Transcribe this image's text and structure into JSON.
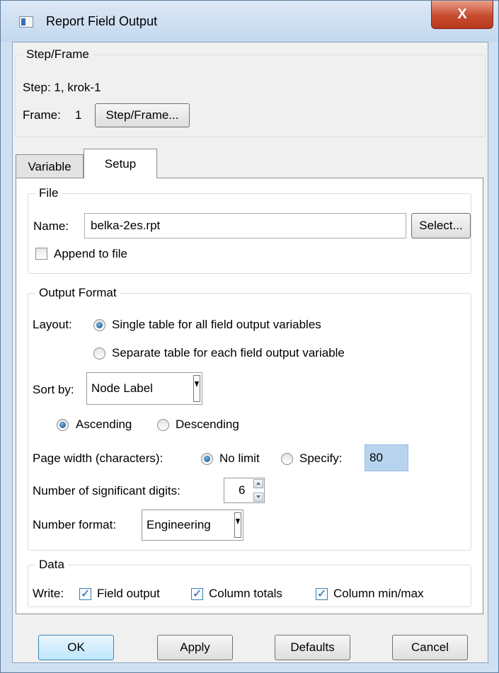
{
  "window": {
    "title": "Report Field Output",
    "close_label": "X"
  },
  "step_frame": {
    "legend": "Step/Frame",
    "step_text": "Step: 1, krok-1",
    "frame_label": "Frame:",
    "frame_value": "1",
    "button_label": "Step/Frame..."
  },
  "tabs": [
    {
      "label": "Variable",
      "selected": false
    },
    {
      "label": "Setup",
      "selected": true
    }
  ],
  "file": {
    "legend": "File",
    "name_label": "Name:",
    "name_value": "belka-2es.rpt",
    "select_label": "Select...",
    "append_label": "Append to file",
    "append_checked": false
  },
  "output_format": {
    "legend": "Output Format",
    "layout_label": "Layout:",
    "layout_options": [
      {
        "label": "Single table for all field output variables",
        "selected": true
      },
      {
        "label": "Separate table for each field output variable",
        "selected": false
      }
    ],
    "sort_label": "Sort by:",
    "sort_value": "Node Label",
    "order_options": [
      {
        "label": "Ascending",
        "selected": true
      },
      {
        "label": "Descending",
        "selected": false
      }
    ],
    "page_width_label": "Page width (characters):",
    "page_width_options": [
      {
        "label": "No limit",
        "selected": true
      },
      {
        "label": "Specify:",
        "selected": false
      }
    ],
    "page_width_value": "80",
    "digits_label": "Number of significant digits:",
    "digits_value": "6",
    "number_format_label": "Number format:",
    "number_format_value": "Engineering"
  },
  "data": {
    "legend": "Data",
    "write_label": "Write:",
    "options": [
      {
        "label": "Field output",
        "checked": true
      },
      {
        "label": "Column totals",
        "checked": true
      },
      {
        "label": "Column min/max",
        "checked": true
      }
    ]
  },
  "buttons": {
    "ok": "OK",
    "apply": "Apply",
    "defaults": "Defaults",
    "cancel": "Cancel"
  }
}
